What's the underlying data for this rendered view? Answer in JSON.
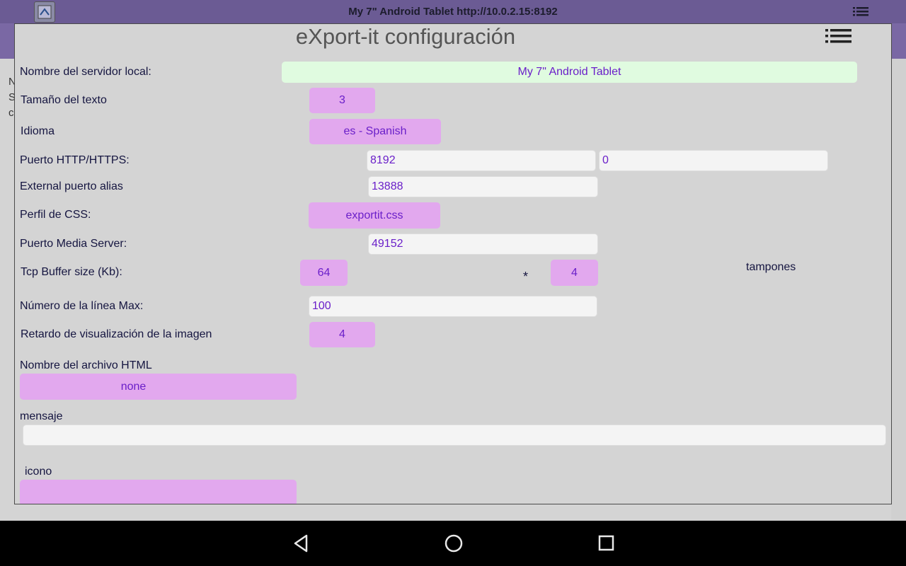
{
  "status_bar": {
    "title": "My 7\" Android Tablet   http://10.0.2.15:8192",
    "menu_icon": "hamburger-list-icon",
    "app_icon": "export-it-app-icon"
  },
  "background": {
    "lines": [
      "N",
      "S",
      "c"
    ]
  },
  "dialog": {
    "title": "eXport-it configuración",
    "menu_icon": "list-menu-icon",
    "server_name": {
      "label": "Nombre del servidor local:",
      "value": "My 7\" Android Tablet"
    },
    "text_size": {
      "label": "Tamaño del texto",
      "value": "3"
    },
    "language": {
      "label": "Idioma",
      "value": "es - Spanish"
    },
    "http_port": {
      "label": "Puerto HTTP/HTTPS:",
      "http": "8192",
      "https": "0"
    },
    "external_port": {
      "label": "External puerto alias",
      "value": "13888"
    },
    "css_profile": {
      "label": "Perfil de CSS:",
      "value": "exportit.css"
    },
    "media_port": {
      "label": "Puerto Media Server:",
      "value": "49152"
    },
    "tcp_buffer": {
      "label": "Tcp Buffer size (Kb):",
      "size": "64",
      "multiply": "*",
      "count": "4",
      "count_label": "tampones"
    },
    "max_lines": {
      "label": "Número de la línea Max:",
      "value": "100"
    },
    "image_delay": {
      "label": "Retardo de visualización de la imagen",
      "value": "4"
    },
    "html_file": {
      "label": "Nombre del archivo HTML",
      "value": "none"
    },
    "message": {
      "label": "mensaje",
      "value": ""
    },
    "icon": {
      "label": "icono",
      "value": ""
    }
  },
  "nav": {
    "back": "back-icon",
    "home": "home-icon",
    "recents": "recents-icon"
  },
  "colors": {
    "status_bar": "#6b5b94",
    "dialog_bg": "#d4d4d4",
    "button_bg": "#e2a8ee",
    "value_text": "#6a1fc9",
    "server_field_bg": "#e0fbe0"
  }
}
